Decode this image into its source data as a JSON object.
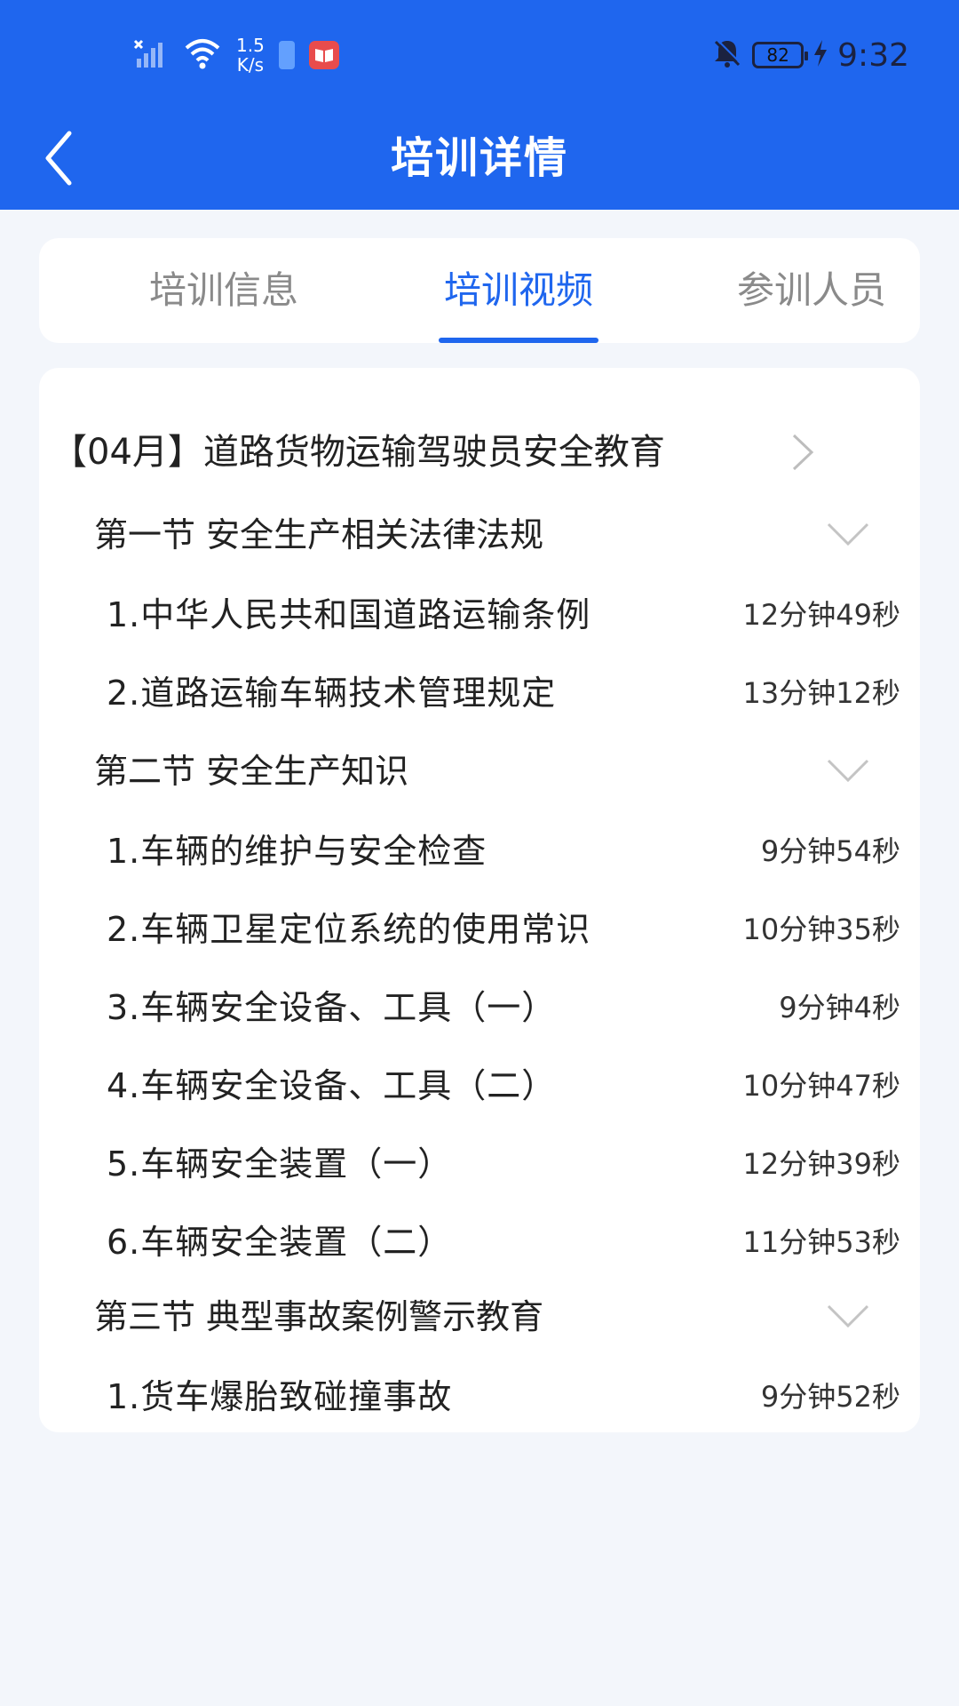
{
  "status_bar": {
    "net_speed_value": "1.5",
    "net_speed_unit": "K/s",
    "battery": "82",
    "time": "9:32"
  },
  "header": {
    "title": "培训详情"
  },
  "tabs": [
    {
      "label": "培训信息",
      "active": false
    },
    {
      "label": "培训视频",
      "active": true
    },
    {
      "label": "参训人员",
      "active": false
    }
  ],
  "course": {
    "title": "【04月】道路货物运输驾驶员安全教育"
  },
  "sections": [
    {
      "title": "第一节 安全生产相关法律法规",
      "lessons": [
        {
          "title": "1.中华人民共和国道路运输条例",
          "duration": "12分钟49秒"
        },
        {
          "title": "2.道路运输车辆技术管理规定",
          "duration": "13分钟12秒"
        }
      ]
    },
    {
      "title": "第二节 安全生产知识",
      "lessons": [
        {
          "title": "1.车辆的维护与安全检查",
          "duration": "9分钟54秒"
        },
        {
          "title": "2.车辆卫星定位系统的使用常识",
          "duration": "10分钟35秒"
        },
        {
          "title": "3.车辆安全设备、工具（一）",
          "duration": "9分钟4秒"
        },
        {
          "title": "4.车辆安全设备、工具（二）",
          "duration": "10分钟47秒"
        },
        {
          "title": "5.车辆安全装置（一）",
          "duration": "12分钟39秒"
        },
        {
          "title": "6.车辆安全装置（二）",
          "duration": "11分钟53秒"
        }
      ]
    },
    {
      "title": "第三节 典型事故案例警示教育",
      "lessons": [
        {
          "title": "1.货车爆胎致碰撞事故",
          "duration": "9分钟52秒"
        }
      ]
    }
  ],
  "colors": {
    "primary": "#1f66ee",
    "background": "#f3f6fb"
  }
}
